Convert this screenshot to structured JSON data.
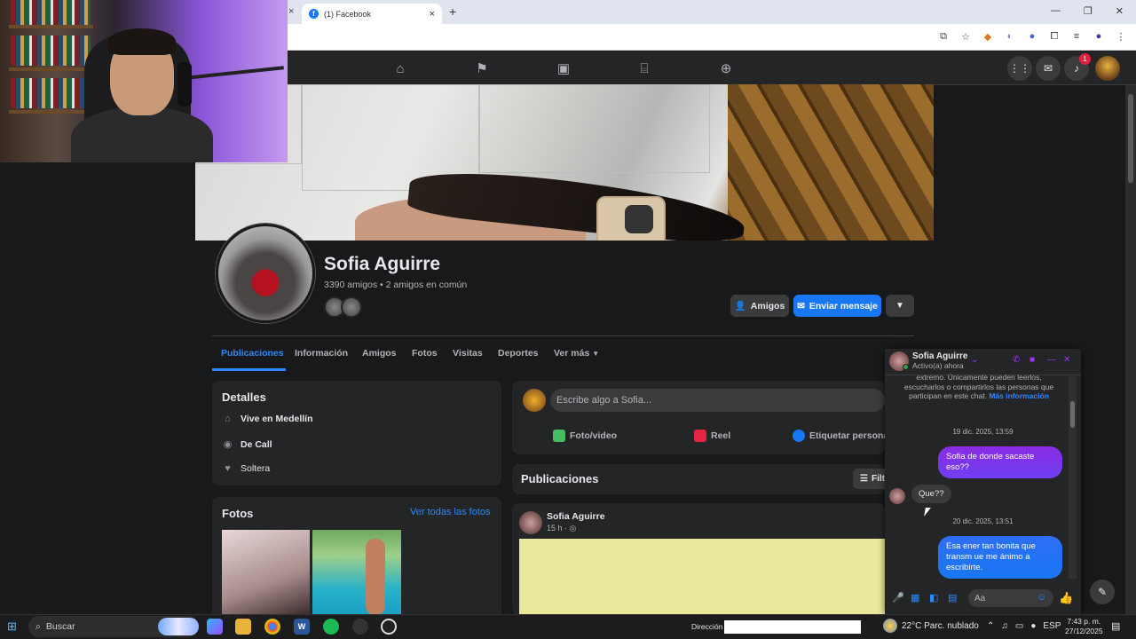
{
  "browser": {
    "tab_title": "(1) Facebook",
    "tab_favicon": "f",
    "new_tab": "+",
    "close_glyph": "×"
  },
  "fb": {
    "notif_count": "1",
    "profile": {
      "name": "Sofia Aguirre",
      "friends_line": "3390 amigos • 2 amigos en común",
      "btn_friends": "Amigos",
      "btn_message": "Enviar mensaje"
    },
    "tabs": [
      "Publicaciones",
      "Información",
      "Amigos",
      "Fotos",
      "Visitas",
      "Deportes",
      "Ver más"
    ],
    "details": {
      "title": "Detalles",
      "items": [
        "Vive en Medellín",
        "De Call",
        "Soltera"
      ]
    },
    "photos": {
      "title": "Fotos",
      "see_all": "Ver todas las fotos"
    },
    "composer": {
      "placeholder": "Escribe algo a Sofia...",
      "actions": [
        "Foto/video",
        "Reel",
        "Etiquetar persona"
      ]
    },
    "posts": {
      "title": "Publicaciones",
      "filter": "Filt",
      "author": "Sofia Aguirre",
      "time": "15 h ·"
    }
  },
  "chat": {
    "name": "Sofia Aguirre",
    "status": "Activo(a) ahora",
    "info_text": "extremo. Únicamente pueden leerlos, escucharlos o compartirlos las personas que participan en este chat.",
    "info_link": "Más información",
    "date1": "19 dic. 2025, 13:59",
    "msg1": "Sofia de donde sacaste eso??",
    "msg2": "Que??",
    "date2": "20 dic. 2025, 13:51",
    "msg3": "Esa ener   tan bonita que transm    ue me ánimo a escribirte.",
    "input_placeholder": "Aa"
  },
  "taskbar": {
    "search": "Buscar",
    "address_label": "Dirección",
    "weather": "22°C  Parc. nublado",
    "lang": "ESP",
    "time": "7:43 p. m.",
    "date": "27/12/2025"
  },
  "colors": {
    "fb_blue": "#1877f2",
    "messenger_purple": "#8a2be2",
    "background": "#18191a",
    "card": "#242526"
  }
}
